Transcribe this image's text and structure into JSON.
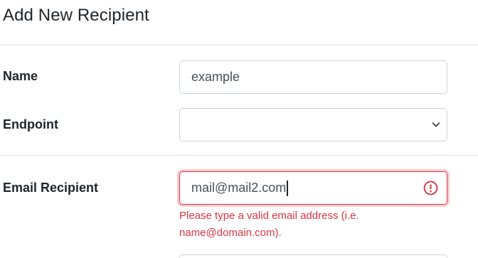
{
  "title": "Add New Recipient",
  "fields": {
    "name": {
      "label": "Name",
      "value": "example"
    },
    "endpoint": {
      "label": "Endpoint",
      "selected": ""
    },
    "email": {
      "label": "Email Recipient",
      "value": "mail@mail2.com",
      "error": "Please type a valid email address (i.e. name@domain.com)."
    }
  },
  "colors": {
    "error": "#dc3545",
    "border": "#ced4da",
    "text": "#212529"
  },
  "icons": {
    "select_chevron": "chevron-down-icon",
    "invalid": "exclamation-circle-icon"
  }
}
